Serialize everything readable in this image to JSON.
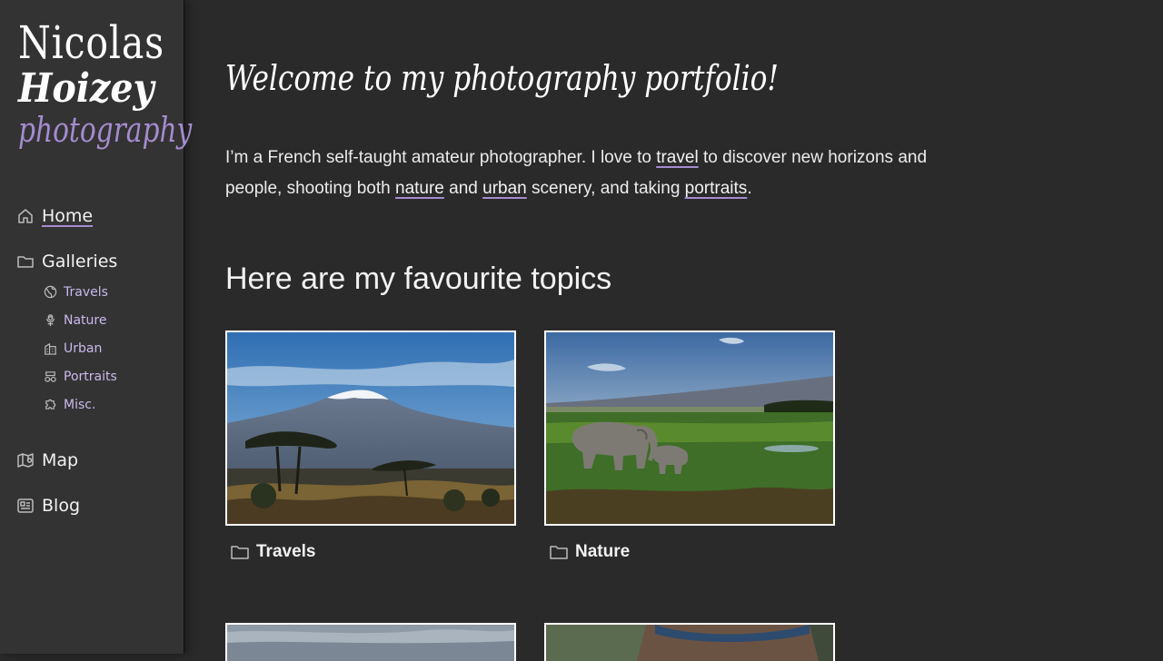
{
  "logo": {
    "first_name": "Nicolas",
    "last_name": "Hoizey",
    "tagline": "photography"
  },
  "nav": {
    "home": "Home",
    "galleries": "Galleries",
    "gallery_items": [
      "Travels",
      "Nature",
      "Urban",
      "Portraits",
      "Misc."
    ],
    "map": "Map",
    "blog": "Blog"
  },
  "main": {
    "title": "Welcome to my photography portfolio!",
    "intro": {
      "p1": "I’m a French self-taught amateur photographer. I love to ",
      "link_travel": "travel",
      "p2": " to discover new horizons and people, shooting both ",
      "link_nature": "nature",
      "p3": " and ",
      "link_urban": "urban",
      "p4": " scenery, and taking ",
      "link_portraits": "portraits",
      "p5": "."
    },
    "topics_heading": "Here are my favourite topics",
    "topics": [
      "Travels",
      "Nature"
    ]
  },
  "colors": {
    "background": "#2a2a2a",
    "sidebar": "#333333",
    "accent": "#a48cd0",
    "sub_link": "#c9b9ec"
  },
  "icons": {
    "home": "home-icon",
    "galleries": "folder-icon",
    "travels": "globe-icon",
    "nature": "flower-icon",
    "urban": "building-icon",
    "portraits": "glasses-icon",
    "misc": "puzzle-icon",
    "map": "map-icon",
    "blog": "news-icon",
    "topic": "folder-icon"
  }
}
